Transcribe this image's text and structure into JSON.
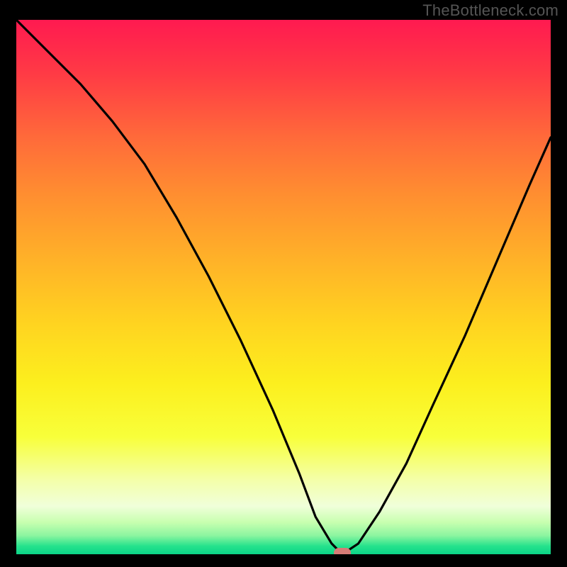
{
  "watermark": "TheBottleneck.com",
  "colors": {
    "frame": "#000000",
    "watermark_text": "#555555",
    "curve": "#000000",
    "marker": "#d67b76"
  },
  "chart_data": {
    "type": "line",
    "title": "",
    "xlabel": "",
    "ylabel": "",
    "xlim": [
      0,
      100
    ],
    "ylim": [
      0,
      100
    ],
    "grid": false,
    "legend": false,
    "notes": "Background is a vertical heat gradient (red→yellow→green). Single black curve descends from top-left to a minimum near x≈61 then rises toward upper-right. A small rounded marker sits at the minimum.",
    "series": [
      {
        "name": "bottleneck-curve",
        "x": [
          0,
          6,
          12,
          18,
          24,
          30,
          36,
          42,
          48,
          53,
          56,
          59,
          61,
          64,
          68,
          73,
          78,
          84,
          90,
          96,
          100
        ],
        "values": [
          100,
          94,
          88,
          81,
          73,
          63,
          52,
          40,
          27,
          15,
          7,
          2,
          0,
          2,
          8,
          17,
          28,
          41,
          55,
          69,
          78
        ]
      }
    ],
    "annotations": [
      {
        "name": "min-marker",
        "x": 61,
        "y": 0
      }
    ],
    "background_gradient_stops": [
      {
        "pos": 0.0,
        "color": "#ff1a50"
      },
      {
        "pos": 0.22,
        "color": "#ff6a3a"
      },
      {
        "pos": 0.57,
        "color": "#ffd420"
      },
      {
        "pos": 0.86,
        "color": "#f4ffa8"
      },
      {
        "pos": 1.0,
        "color": "#0bd488"
      }
    ]
  }
}
